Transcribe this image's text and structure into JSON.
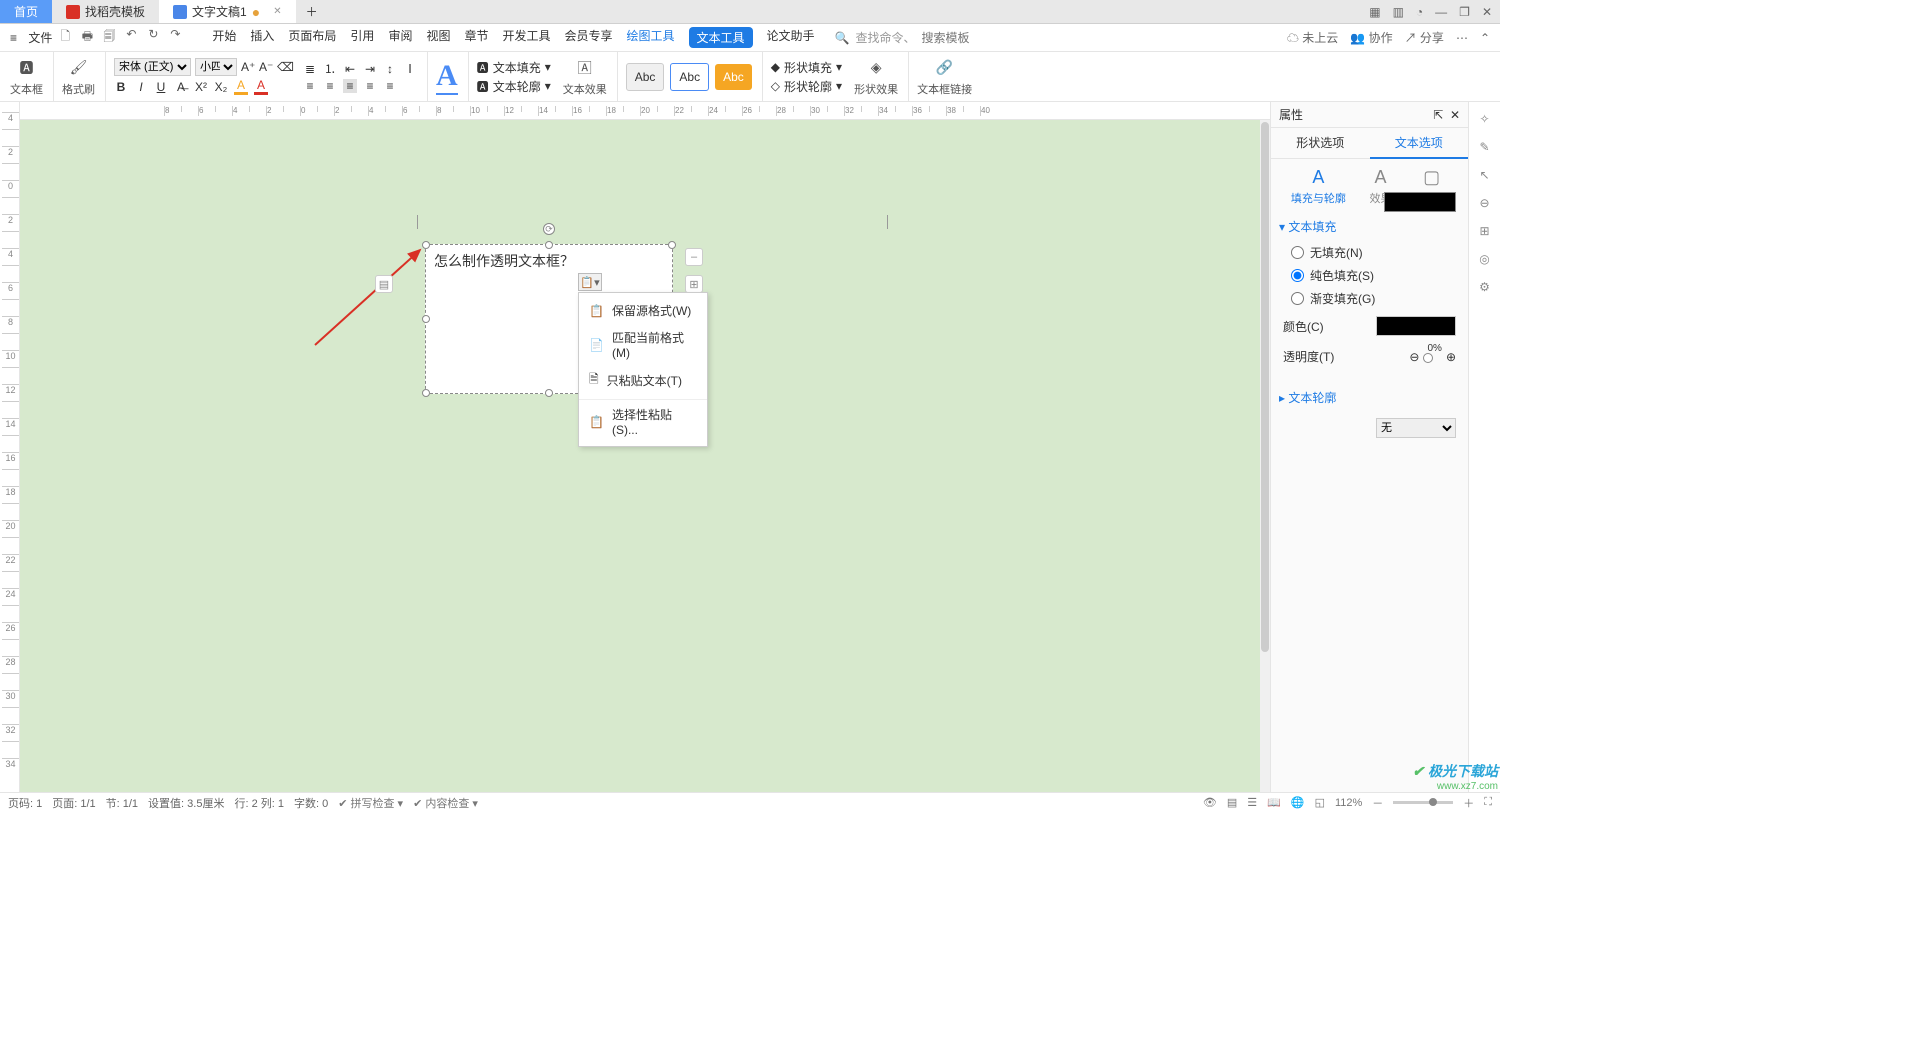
{
  "tabs": {
    "home": "首页",
    "t1": "找稻壳模板",
    "t2": "文字文稿1",
    "newtab": "＋"
  },
  "window_controls": {
    "grid": "▦",
    "apps": "▥",
    "skin": "◔",
    "min": "—",
    "max": "❐",
    "close": "✕"
  },
  "quickbar": {
    "file_icon": "≡",
    "file": "文件",
    "icons": [
      "🗋",
      "🖶",
      "🗐",
      "↶",
      "↻",
      "↷"
    ],
    "menus": [
      "开始",
      "插入",
      "页面布局",
      "引用",
      "审阅",
      "视图",
      "章节",
      "开发工具",
      "会员专享"
    ],
    "draw_tool": "绘图工具",
    "text_tool": "文本工具",
    "paper": "论文助手",
    "search_lbl": "查找命令、",
    "search_ph": "搜索模板",
    "right": {
      "cloud": "未上云",
      "coop": "协作",
      "share": "分享",
      "more": "⋯",
      "arrow": "⌃"
    }
  },
  "ribbon": {
    "textbox": "文本框",
    "format": "格式刷",
    "font": "宋体 (正文)",
    "size": "小四",
    "fill": "文本填充",
    "outline": "文本轮廓",
    "effect": "文本效果",
    "abc": "Abc",
    "shapeFill": "形状填充",
    "shapeOutline": "形状轮廓",
    "shapeEffect": "形状效果",
    "link": "文本框链接"
  },
  "panel": {
    "title": "属性",
    "tabs": {
      "shape": "形状选项",
      "text": "文本选项"
    },
    "subtabs": {
      "fill": "填充与轮廓",
      "effect": "效果",
      "box": "文本框"
    },
    "section_fill": "文本填充",
    "radio_none": "无填充(N)",
    "radio_solid": "纯色填充(S)",
    "radio_grad": "渐变填充(G)",
    "color": "颜色(C)",
    "opacity": "透明度(T)",
    "opacity_val": "0%",
    "section_outline": "文本轮廓",
    "outline_val": "无"
  },
  "doc": {
    "textbox_text": "怎么制作透明文本框？",
    "paste_menu": [
      {
        "icon": "📋",
        "label": "保留源格式(W)"
      },
      {
        "icon": "📄",
        "label": "匹配当前格式(M)"
      },
      {
        "icon": "🗎",
        "label": "只粘贴文本(T)"
      },
      {
        "icon": "📋",
        "label": "选择性粘贴(S)..."
      }
    ]
  },
  "status": {
    "items": [
      "页码: 1",
      "页面: 1/1",
      "节: 1/1",
      "设置值: 3.5厘米",
      "行: 2  列: 1",
      "字数: 0"
    ],
    "spell": "拼写检查",
    "content": "内容检查",
    "zoom": "112%"
  },
  "watermark": {
    "brand": "极光下载站",
    "url": "www.xz7.com"
  }
}
